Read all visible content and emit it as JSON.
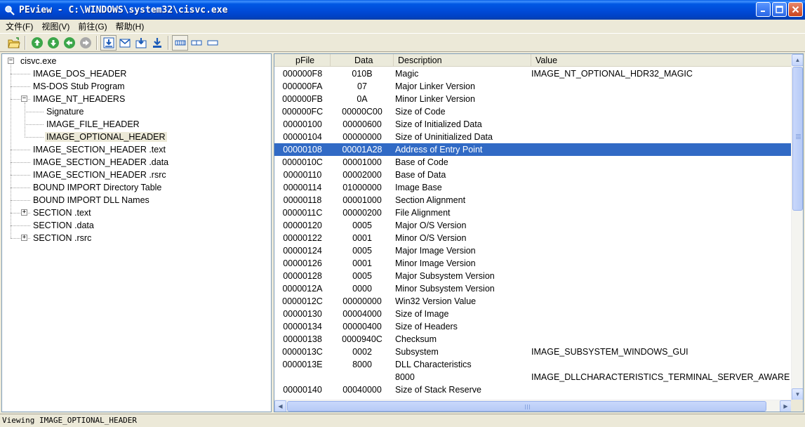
{
  "window": {
    "title": "PEview - C:\\WINDOWS\\system32\\cisvc.exe",
    "app_icon": "magnifier-icon"
  },
  "menu": [
    "文件(F)",
    "视图(V)",
    "前往(G)",
    "帮助(H)"
  ],
  "toolbar": {
    "buttons": [
      "open-file-icon",
      "back-icon",
      "forward-icon",
      "previous-icon",
      "next-icon",
      "view-hex-icon",
      "view-bytes-icon",
      "view-words-icon",
      "view-dwords-icon",
      "byte-mode-icon",
      "word-mode-icon",
      "dword-mode-icon"
    ]
  },
  "tree": {
    "items": [
      {
        "label": "cisvc.exe",
        "expander": "-"
      },
      {
        "label": "IMAGE_DOS_HEADER"
      },
      {
        "label": "MS-DOS Stub Program"
      },
      {
        "label": "IMAGE_NT_HEADERS",
        "expander": "-"
      },
      {
        "label": "Signature"
      },
      {
        "label": "IMAGE_FILE_HEADER"
      },
      {
        "label": "IMAGE_OPTIONAL_HEADER",
        "selected": true
      },
      {
        "label": "IMAGE_SECTION_HEADER .text"
      },
      {
        "label": "IMAGE_SECTION_HEADER .data"
      },
      {
        "label": "IMAGE_SECTION_HEADER .rsrc"
      },
      {
        "label": "BOUND IMPORT Directory Table"
      },
      {
        "label": "BOUND IMPORT DLL Names"
      },
      {
        "label": "SECTION .text",
        "expander": "+"
      },
      {
        "label": "SECTION .data"
      },
      {
        "label": "SECTION .rsrc",
        "expander": "+"
      }
    ]
  },
  "list": {
    "columns": [
      "pFile",
      "Data",
      "Description",
      "Value"
    ],
    "rows": [
      {
        "pfile": "000000F8",
        "data": "010B",
        "desc": "Magic",
        "value": "IMAGE_NT_OPTIONAL_HDR32_MAGIC"
      },
      {
        "pfile": "000000FA",
        "data": "07",
        "desc": "Major Linker Version",
        "value": ""
      },
      {
        "pfile": "000000FB",
        "data": "0A",
        "desc": "Minor Linker Version",
        "value": ""
      },
      {
        "pfile": "000000FC",
        "data": "00000C00",
        "desc": "Size of Code",
        "value": ""
      },
      {
        "pfile": "00000100",
        "data": "00000600",
        "desc": "Size of Initialized Data",
        "value": ""
      },
      {
        "pfile": "00000104",
        "data": "00000000",
        "desc": "Size of Uninitialized Data",
        "value": ""
      },
      {
        "pfile": "00000108",
        "data": "00001A28",
        "desc": "Address of Entry Point",
        "value": "",
        "selected": true
      },
      {
        "pfile": "0000010C",
        "data": "00001000",
        "desc": "Base of Code",
        "value": ""
      },
      {
        "pfile": "00000110",
        "data": "00002000",
        "desc": "Base of Data",
        "value": ""
      },
      {
        "pfile": "00000114",
        "data": "01000000",
        "desc": "Image Base",
        "value": ""
      },
      {
        "pfile": "00000118",
        "data": "00001000",
        "desc": "Section Alignment",
        "value": ""
      },
      {
        "pfile": "0000011C",
        "data": "00000200",
        "desc": "File Alignment",
        "value": ""
      },
      {
        "pfile": "00000120",
        "data": "0005",
        "desc": "Major O/S Version",
        "value": ""
      },
      {
        "pfile": "00000122",
        "data": "0001",
        "desc": "Minor O/S Version",
        "value": ""
      },
      {
        "pfile": "00000124",
        "data": "0005",
        "desc": "Major Image Version",
        "value": ""
      },
      {
        "pfile": "00000126",
        "data": "0001",
        "desc": "Minor Image Version",
        "value": ""
      },
      {
        "pfile": "00000128",
        "data": "0005",
        "desc": "Major Subsystem Version",
        "value": ""
      },
      {
        "pfile": "0000012A",
        "data": "0000",
        "desc": "Minor Subsystem Version",
        "value": ""
      },
      {
        "pfile": "0000012C",
        "data": "00000000",
        "desc": "Win32 Version Value",
        "value": ""
      },
      {
        "pfile": "00000130",
        "data": "00004000",
        "desc": "Size of Image",
        "value": ""
      },
      {
        "pfile": "00000134",
        "data": "00000400",
        "desc": "Size of Headers",
        "value": ""
      },
      {
        "pfile": "00000138",
        "data": "0000940C",
        "desc": "Checksum",
        "value": ""
      },
      {
        "pfile": "0000013C",
        "data": "0002",
        "desc": "Subsystem",
        "value": "IMAGE_SUBSYSTEM_WINDOWS_GUI"
      },
      {
        "pfile": "0000013E",
        "data": "8000",
        "desc": "DLL Characteristics",
        "value": ""
      },
      {
        "pfile": "",
        "data": "",
        "desc": "8000",
        "value": "IMAGE_DLLCHARACTERISTICS_TERMINAL_SERVER_AWARE"
      },
      {
        "pfile": "00000140",
        "data": "00040000",
        "desc": "Size of Stack Reserve",
        "value": ""
      }
    ]
  },
  "status": {
    "text": "Viewing IMAGE_OPTIONAL_HEADER"
  }
}
